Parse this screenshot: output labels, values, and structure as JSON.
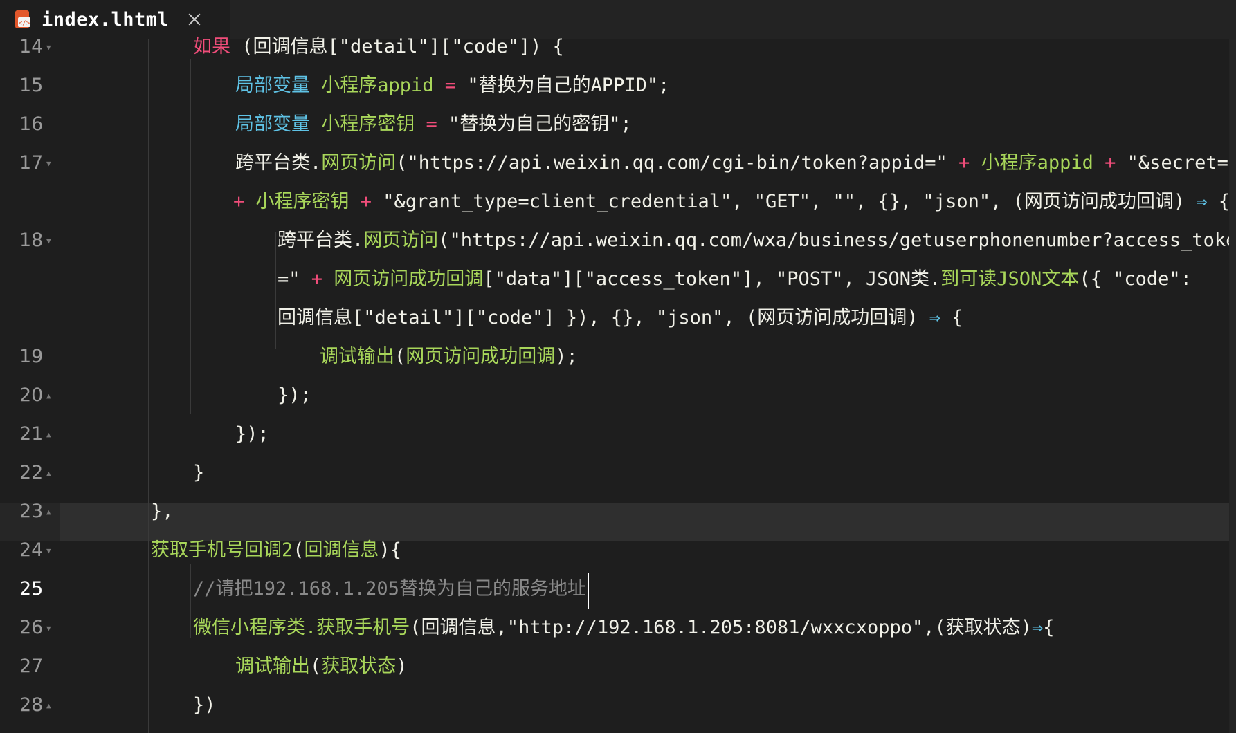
{
  "tab": {
    "title": "index.lhtml",
    "icon": "html-file-icon"
  },
  "gutter": {
    "line_numbers": [
      "14",
      "15",
      "16",
      "17",
      "",
      "18",
      "",
      "",
      "19",
      "20",
      "21",
      "22",
      "23",
      "24",
      "25",
      "26",
      "27",
      "28"
    ]
  },
  "colors": {
    "background": "#1e1e1e",
    "keyword": "#f04d7a",
    "type": "#5fc3e6",
    "function": "#a8d65a",
    "comment": "#8a8a8a",
    "current_line": "#2f2f2f"
  },
  "code": {
    "l14": [
      "如果",
      " (回调信息[\"detail\"][\"code\"]) {"
    ],
    "l15": [
      "局部变量",
      " 小程序appid ",
      "=",
      " \"替换为自己的APPID\";"
    ],
    "l16": [
      "局部变量",
      " 小程序密钥 ",
      "=",
      " \"替换为自己的密钥\";"
    ],
    "l17a": [
      "跨平台类.",
      "网页访问",
      "(\"https://api.weixin.qq.com/cgi-bin/token?appid=\" ",
      "+",
      " 小程序appid ",
      "+",
      " \"&secret=\""
    ],
    "l17b": [
      "+",
      " 小程序密钥 ",
      "+",
      " \"&grant_type=client_credential\", \"GET\", \"\", {}, \"json\", (网页访问成功回调) ",
      "⇒",
      " {"
    ],
    "l18a": [
      "跨平台类.",
      "网页访问",
      "(\"https://api.weixin.qq.com/wxa/business/getuserphonenumber?access_token"
    ],
    "l18b": [
      "=\" ",
      "+",
      " 网页访问成功回调",
      "[\"data\"][\"access_token\"], \"POST\", JSON类.",
      "到可读JSON文本",
      "({ \"code\":"
    ],
    "l18c": [
      "回调信息[\"detail\"][\"code\"] }), {}, \"json\", (网页访问成功回调) ",
      "⇒",
      " {"
    ],
    "l19": [
      "调试输出",
      "(",
      "网页访问成功回调",
      ");"
    ],
    "l20": "});",
    "l21": "});",
    "l22": "}",
    "l23": "},",
    "l24": [
      "获取手机号回调2",
      "(",
      "回调信息",
      "){"
    ],
    "l25": "//请把192.168.1.205替换为自己的服务地址",
    "l26": [
      "微信小程序类.",
      "获取手机号",
      "(回调信息,\"http://192.168.1.205:8081/wxxcxoppo\",(获取状态)",
      "⇒",
      "{"
    ],
    "l27": [
      "调试输出",
      "(",
      "获取状态",
      ")"
    ],
    "l28": "})"
  }
}
